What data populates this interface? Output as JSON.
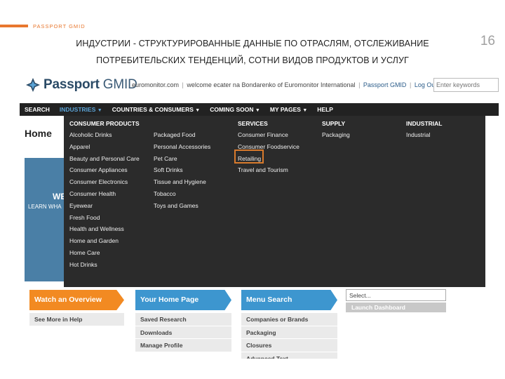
{
  "slide": {
    "label": "PASSPORT GMID",
    "title": "ИНДУСТРИИ - СТРУКТУРИРОВАННЫЕ ДАННЫЕ ПО ОТРАСЛЯМ, ОТСЛЕЖИВАНИЕ ПОТРЕБИТЕЛЬСКИХ ТЕНДЕНЦИЙ, СОТНИ ВИДОВ ПРОДУКТОВ И УСЛУГ",
    "page_number": "16",
    "accent_color": "#e8772e"
  },
  "header": {
    "logo_bold": "Passport",
    "logo_light": " GMID",
    "site": "euromonitor.com",
    "welcome": "welcome ecater na Bondarenko of Euromonitor International",
    "product_link": "Passport GMID",
    "logout": "Log Out",
    "search_placeholder": "Enter keywords"
  },
  "nav": {
    "search": "SEARCH",
    "industries": "INDUSTRIES",
    "countries": "COUNTRIES & CONSUMERS",
    "coming_soon": "COMING SOON",
    "my_pages": "MY PAGES",
    "help": "HELP",
    "caret": "▼"
  },
  "page": {
    "title": "Home",
    "hero_we": "WE",
    "hero_learn": "LEARN WHA"
  },
  "dropdown": {
    "consumer_products": {
      "heading": "CONSUMER PRODUCTS",
      "col1": [
        "Alcoholic Drinks",
        "Apparel",
        "Beauty and Personal Care",
        "Consumer Appliances",
        "Consumer Electronics",
        "Consumer Health",
        "Eyewear",
        "Fresh Food",
        "Health and Wellness",
        "Home and Garden",
        "Home Care",
        "Hot Drinks"
      ],
      "col2": [
        "Packaged Food",
        "Personal Accessories",
        "Pet Care",
        "Soft Drinks",
        "Tissue and Hygiene",
        "Tobacco",
        "Toys and Games"
      ]
    },
    "services": {
      "heading": "SERVICES",
      "items": [
        "Consumer Finance",
        "Consumer Foodservice",
        "Retailing",
        "Travel and Tourism"
      ]
    },
    "supply": {
      "heading": "SUPPLY",
      "items": [
        "Packaging"
      ]
    },
    "industrial": {
      "heading": "INDUSTRIAL",
      "items": [
        "Industrial"
      ]
    },
    "highlight_color": "#d87a2c"
  },
  "widgets": {
    "watch_overview": "Watch an Overview",
    "your_home_page": "Your Home Page",
    "menu_search": "Menu Search",
    "select_value": "Select...",
    "launch_dashboard": "Launch Dashboard",
    "list0": [
      "See More in Help"
    ],
    "list1": [
      "Saved Research",
      "Downloads",
      "Manage Profile"
    ],
    "list2": [
      "Companies or Brands",
      "Packaging",
      "Closures",
      "Advanced Text"
    ]
  }
}
